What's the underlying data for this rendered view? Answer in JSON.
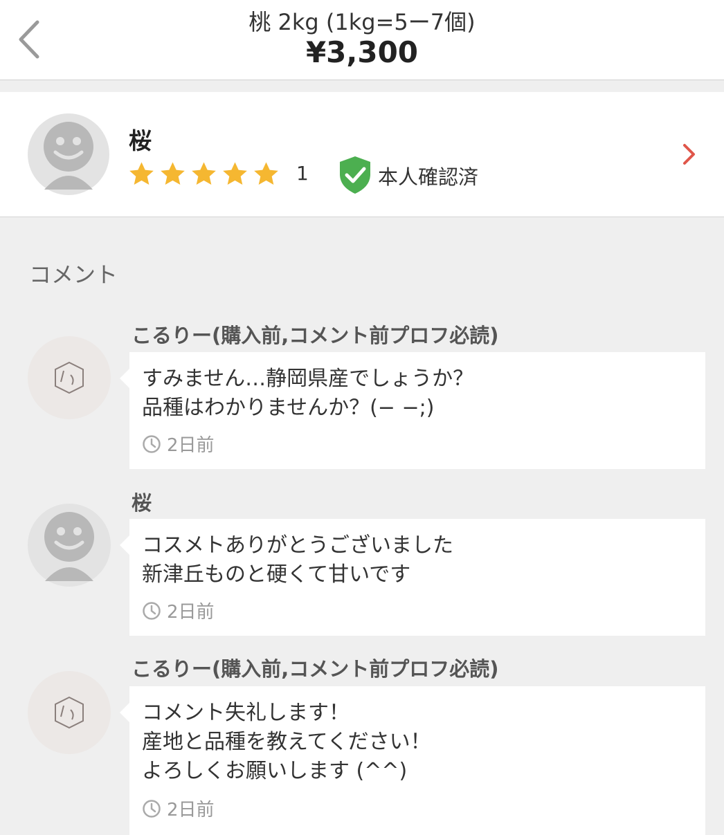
{
  "header": {
    "title": "桃 2kg (1kg=5ー7個)",
    "price": "¥3,300"
  },
  "seller": {
    "name": "桜",
    "rating_stars": 5,
    "rating_count": "1",
    "verified_label": "本人確認済"
  },
  "comments_section": {
    "heading": "コメント",
    "items": [
      {
        "author": "こるりー(購入前,コメント前プロフ必読)",
        "text": "すみません…静岡県産でしょうか？\n品種はわかりませんか？(− −;)",
        "time": "2日前"
      },
      {
        "author": "桜",
        "text": "コスメトありがとうございました\n新津丘ものと硬くて甘いです",
        "time": "2日前"
      },
      {
        "author": "こるりー(購入前,コメント前プロフ必読)",
        "text": "コメント失礼します！\n産地と品種を教えてください！\nよろしくお願いします (^^)",
        "time": "2日前"
      }
    ]
  },
  "colors": {
    "star": "#f5b731",
    "verified": "#4caf50",
    "chevron": "#e0564a",
    "background": "#efefef"
  }
}
